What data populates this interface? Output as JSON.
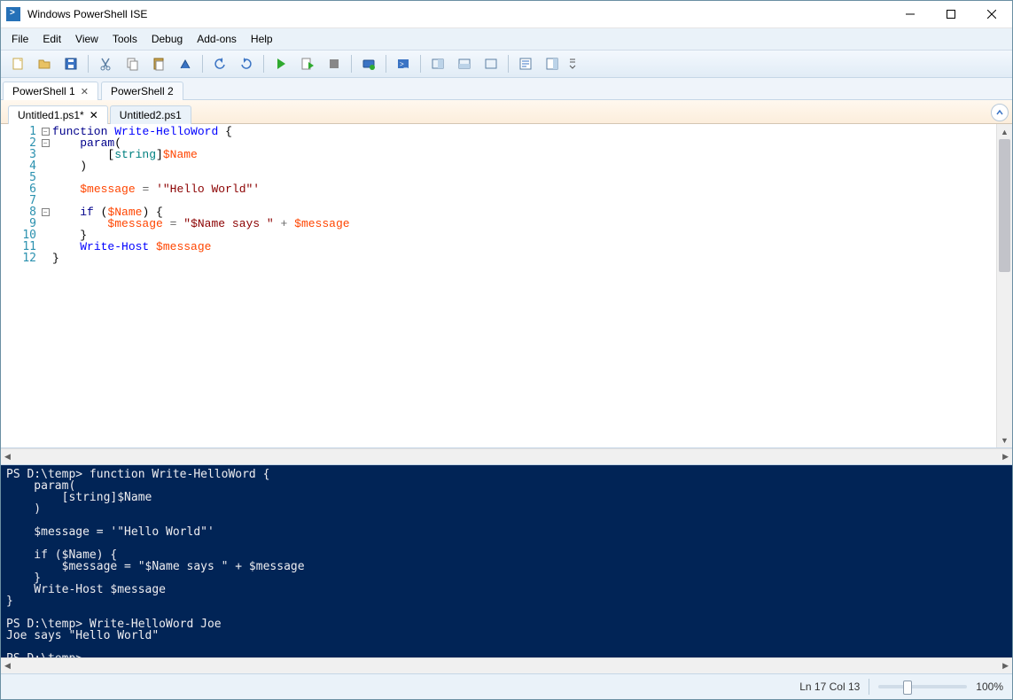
{
  "window": {
    "title": "Windows PowerShell ISE"
  },
  "menu": {
    "items": [
      "File",
      "Edit",
      "View",
      "Tools",
      "Debug",
      "Add-ons",
      "Help"
    ]
  },
  "outerTabs": [
    {
      "label": "PowerShell 1",
      "active": true,
      "closable": true
    },
    {
      "label": "PowerShell 2",
      "active": false,
      "closable": false
    }
  ],
  "scriptTabs": [
    {
      "label": "Untitled1.ps1*",
      "active": true,
      "closable": true
    },
    {
      "label": "Untitled2.ps1",
      "active": false,
      "closable": false
    }
  ],
  "editor": {
    "lineCount": 12,
    "code_html": [
      "<span class='kw'>function</span> <span class='cmd'>Write-HelloWord</span> {",
      "    <span class='kw'>param</span>(",
      "        [<span class='type'>string</span>]<span class='varO'>$Name</span>",
      "    )",
      "",
      "    <span class='varO'>$message</span> <span class='op'>=</span> <span class='str'>'\"Hello World\"'</span>",
      "",
      "    <span class='kw'>if</span> (<span class='varO'>$Name</span>) {",
      "        <span class='varO'>$message</span> <span class='op'>=</span> <span class='str'>\"$Name says \"</span> <span class='op'>+</span> <span class='varO'>$message</span>",
      "    }",
      "    <span class='cmd'>Write-Host</span> <span class='varO'>$message</span>",
      "}"
    ],
    "fold": {
      "1": "-",
      "2": "-",
      "8": "-"
    }
  },
  "console_text": "PS D:\\temp> function Write-HelloWord {\n    param(\n        [string]$Name\n    )\n\n    $message = '\"Hello World\"'\n\n    if ($Name) {\n        $message = \"$Name says \" + $message\n    }\n    Write-Host $message\n}\n\nPS D:\\temp> Write-HelloWord Joe\nJoe says \"Hello World\"\n\nPS D:\\temp> ",
  "status": {
    "position": "Ln 17  Col 13",
    "zoom": "100%"
  }
}
